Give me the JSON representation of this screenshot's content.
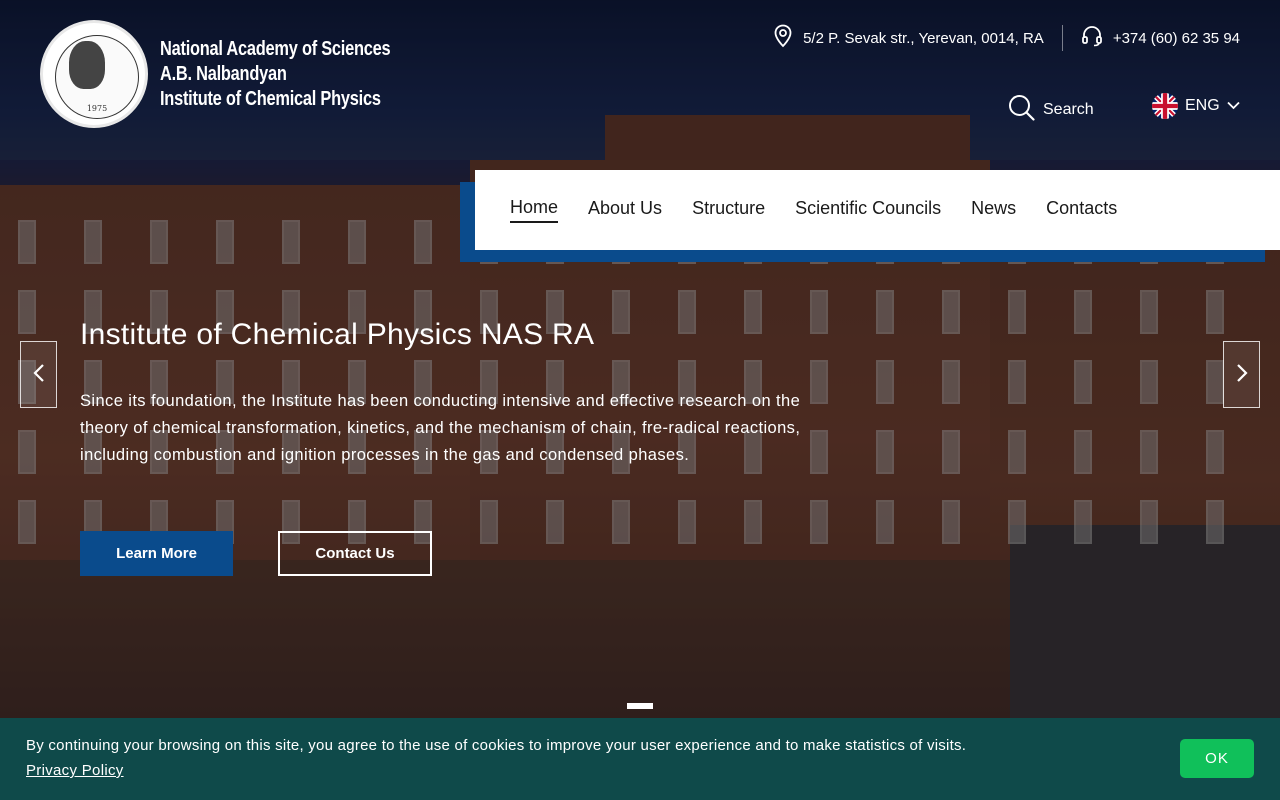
{
  "header": {
    "logo_lines": [
      "National Academy of Sciences",
      "A.B. Nalbandyan",
      "Institute of Chemical Physics"
    ],
    "seal_year": "1975",
    "address": "5/2 P. Sevak str., Yerevan, 0014, RA",
    "phone": "+374 (60) 62 35 94",
    "search_label": "Search",
    "language": "ENG"
  },
  "nav": {
    "items": [
      {
        "label": "Home",
        "active": true
      },
      {
        "label": "About Us"
      },
      {
        "label": "Structure"
      },
      {
        "label": "Scientific Councils"
      },
      {
        "label": "News"
      },
      {
        "label": "Contacts"
      }
    ]
  },
  "slide": {
    "title": "Institute of Chemical Physics NAS RA",
    "text": "Since its foundation, the Institute has been conducting intensive and effective research on the theory of chemical transformation, kinetics, and the mechanism of chain, fre-radical reactions, including combustion and ignition processes in the gas and condensed phases.",
    "primary_button": "Learn More",
    "secondary_button": "Contact Us"
  },
  "cookie": {
    "text": "By continuing your browsing on this site, you agree to the use of cookies to improve your user experience and to make statistics of visits.",
    "link": "Privacy Policy",
    "ok": "OK"
  },
  "colors": {
    "accent_blue": "#0a4b8c",
    "cookie_bg": "#0f4a4a",
    "ok_green": "#10c05a"
  },
  "icons": {
    "address": "location-pin-icon",
    "phone": "headset-icon",
    "search": "search-icon",
    "language": "uk-flag-icon",
    "dropdown": "chevron-down-icon",
    "prev": "chevron-left-icon",
    "next": "chevron-right-icon"
  }
}
